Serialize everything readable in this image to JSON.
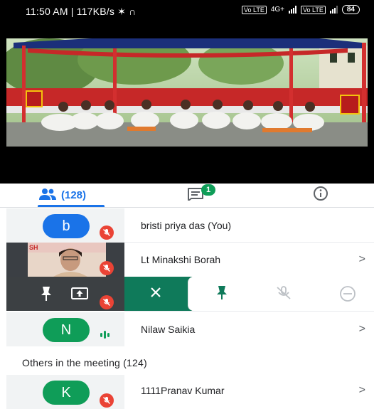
{
  "status_bar": {
    "time": "11:50 AM",
    "speed": "117KB/s",
    "battery": "84",
    "volte1": "Vo LTE",
    "volte2": "Vo LTE",
    "net": "4G+"
  },
  "tabs": {
    "people_count": "(128)",
    "chat_badge": "1"
  },
  "participants": [
    {
      "initial": "b",
      "name": "bristi priya das (You)",
      "avatar_color": "#1a73e8"
    },
    {
      "name": "Lt Minakshi Borah",
      "thumb_text": "SH"
    },
    {
      "initial": "N",
      "name": "Nilaw Saikia",
      "avatar_color": "#0f9d58"
    },
    {
      "initial": "K",
      "name": "1111Pranav Kumar",
      "avatar_color": "#0f9d58"
    }
  ],
  "others_header": "Others in the meeting (124)",
  "chevron": ">",
  "colors": {
    "accent": "#1a73e8",
    "green": "#0f9d58",
    "mute_red": "#ea4335",
    "action_green": "#0f7a5a"
  }
}
